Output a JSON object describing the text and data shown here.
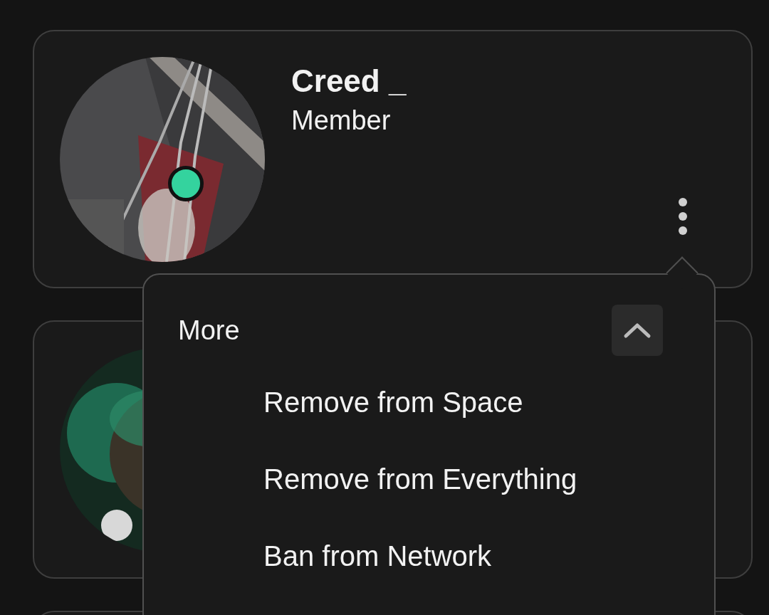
{
  "members": [
    {
      "kind": "member",
      "name": "Creed _",
      "role": "Member",
      "online": true
    },
    {
      "kind": "member"
    },
    {
      "kind": "member"
    }
  ],
  "menu": {
    "title": "More",
    "expanded": true,
    "items": [
      "Remove from Space",
      "Remove from Everything",
      "Ban from Network"
    ]
  }
}
